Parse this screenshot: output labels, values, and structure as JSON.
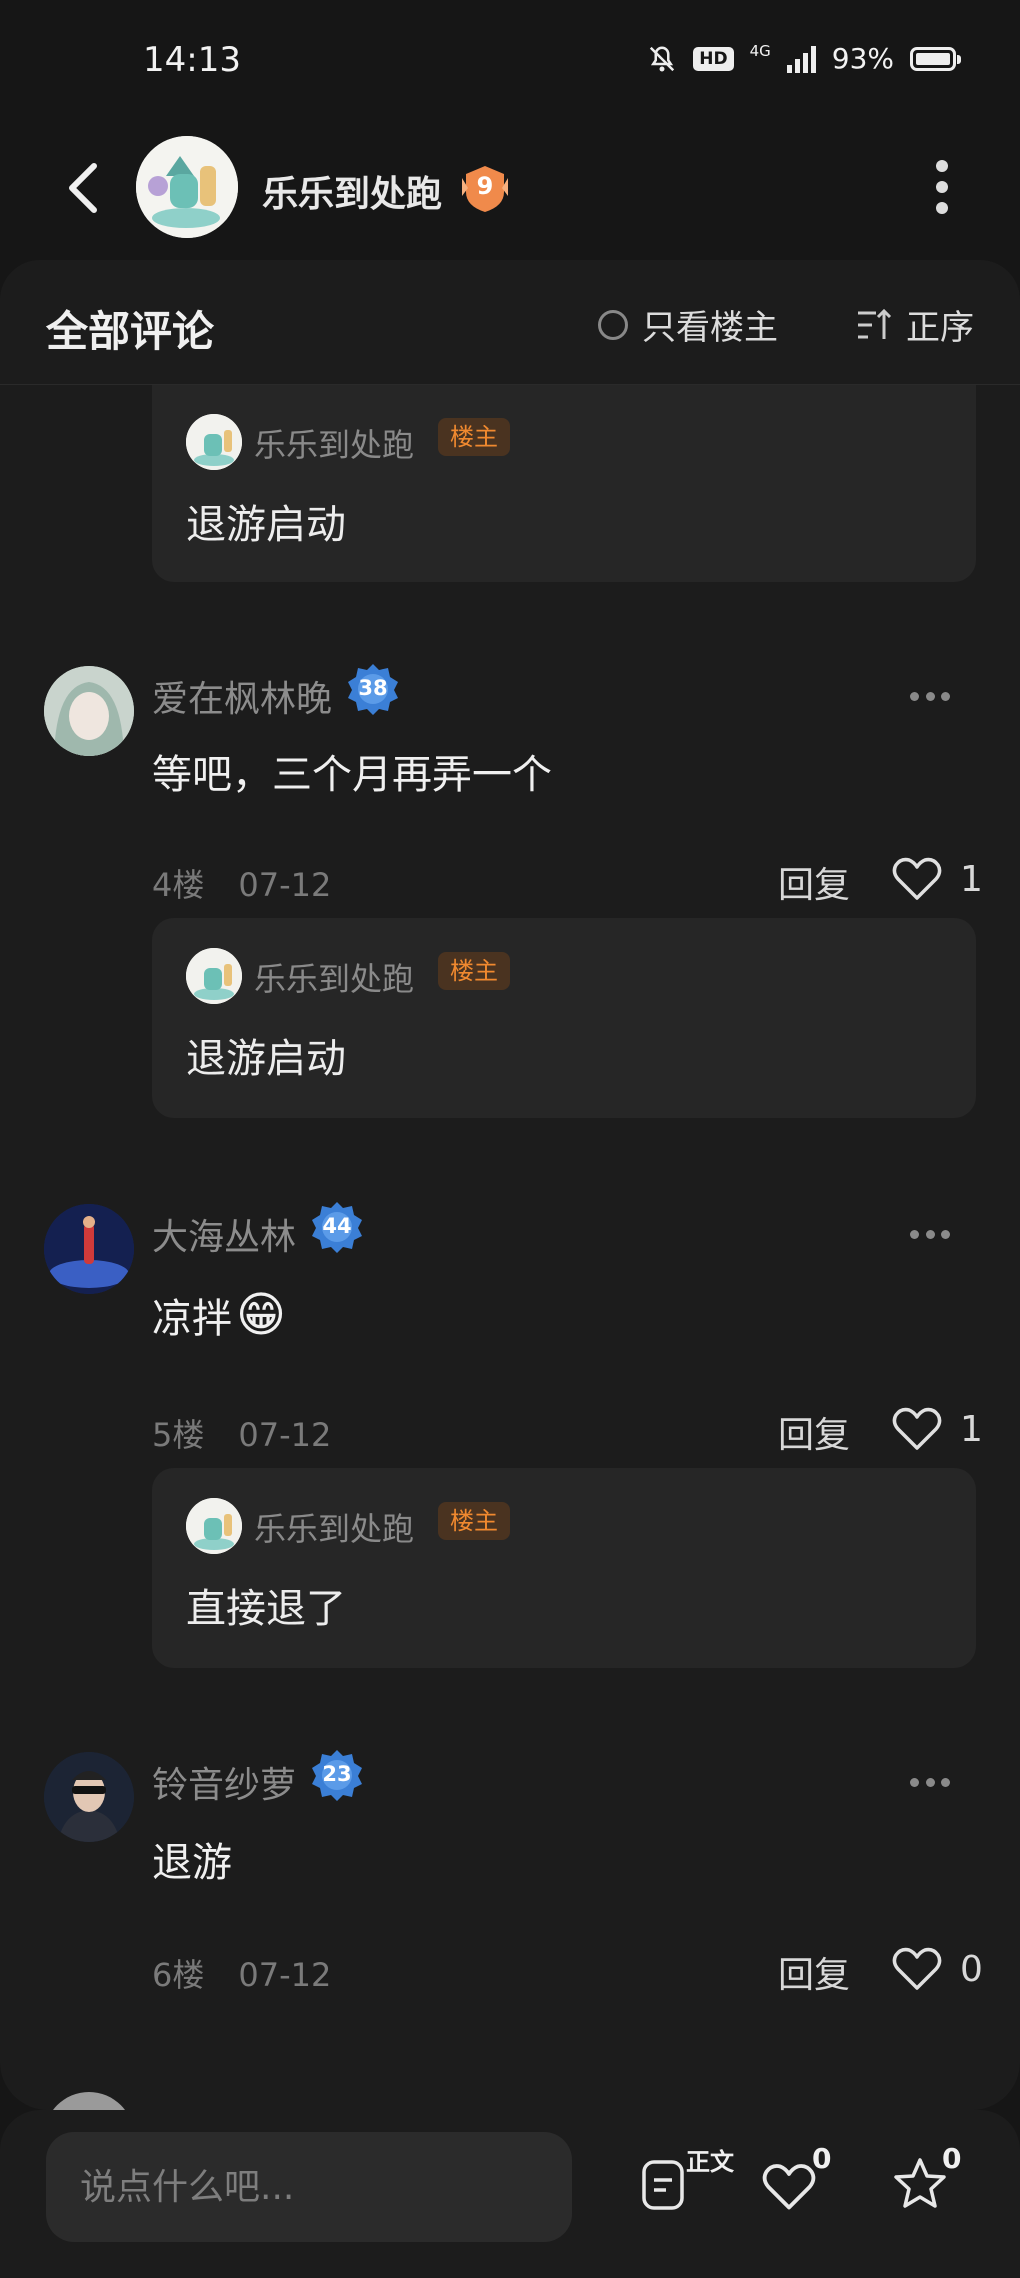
{
  "status_bar": {
    "time": "14:13",
    "network": "4G",
    "battery": "93%"
  },
  "header": {
    "user_name": "乐乐到处跑",
    "level": "9"
  },
  "comments_panel": {
    "title": "全部评论",
    "op_only_label": "只看楼主",
    "sort_label": "正序"
  },
  "op_tag": "楼主",
  "top_reply": {
    "author": "乐乐到处跑",
    "text": "退游启动"
  },
  "comments": [
    {
      "author": "爱在枫林晚",
      "level": "38",
      "text": "等吧，三个月再弄一个",
      "floor": "4楼",
      "date": "07-12",
      "reply_label": "回复",
      "likes": "1",
      "reply": {
        "author": "乐乐到处跑",
        "text": "退游启动"
      }
    },
    {
      "author": "大海丛林",
      "level": "44",
      "text": "凉拌",
      "emoji": "😁",
      "floor": "5楼",
      "date": "07-12",
      "reply_label": "回复",
      "likes": "1",
      "reply": {
        "author": "乐乐到处跑",
        "text": "直接退了"
      }
    },
    {
      "author": "铃音纱萝",
      "level": "23",
      "text": "退游",
      "floor": "6楼",
      "date": "07-12",
      "reply_label": "回复",
      "likes": "0"
    }
  ],
  "bottom_bar": {
    "placeholder": "说点什么吧...",
    "post_label": "正文",
    "like_count": "0",
    "fav_count": "0"
  },
  "colors": {
    "op_tag": "#f0892f",
    "badge_blue": "#3b7fd6",
    "badge_orange": "#f08a4b"
  }
}
